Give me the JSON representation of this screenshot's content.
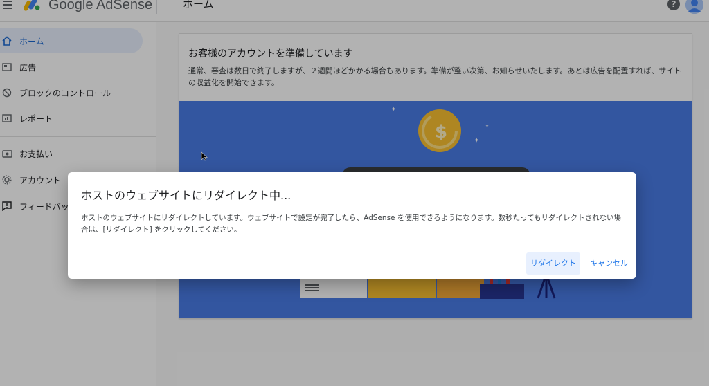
{
  "header": {
    "brand": "Google AdSense",
    "page_title": "ホーム",
    "help_icon": "?"
  },
  "sidebar": {
    "items": [
      {
        "label": "ホーム",
        "icon": "home-icon",
        "active": true
      },
      {
        "label": "広告",
        "icon": "ads-icon"
      },
      {
        "label": "ブロックのコントロール",
        "icon": "block-icon"
      },
      {
        "label": "レポート",
        "icon": "reports-icon"
      },
      {
        "label": "お支払い",
        "icon": "payments-icon"
      },
      {
        "label": "アカウント",
        "icon": "account-gear-icon"
      },
      {
        "label": "フィードバック",
        "icon": "feedback-icon"
      }
    ]
  },
  "card": {
    "title": "お客様のアカウントを準備しています",
    "description": "通常、審査は数日で終了しますが、２週間ほどかかる場合もあります。準備が整い次第、お知らせいたします。あとは広告を配置すれば、サイトの収益化を開始できます。"
  },
  "dialog": {
    "title": "ホストのウェブサイトにリダイレクト中...",
    "body": "ホストのウェブサイトにリダイレクトしています。ウェブサイトで設定が完了したら、AdSense を使用できるようになります。数秒たってもリダイレクトされない場合は、[リダイレクト] をクリックしてください。",
    "redirect_label": "リダイレクト",
    "cancel_label": "キャンセル"
  },
  "colors": {
    "accent": "#1a73e8",
    "illustration_bg": "#4a7be5",
    "coin": "#f9c132"
  }
}
